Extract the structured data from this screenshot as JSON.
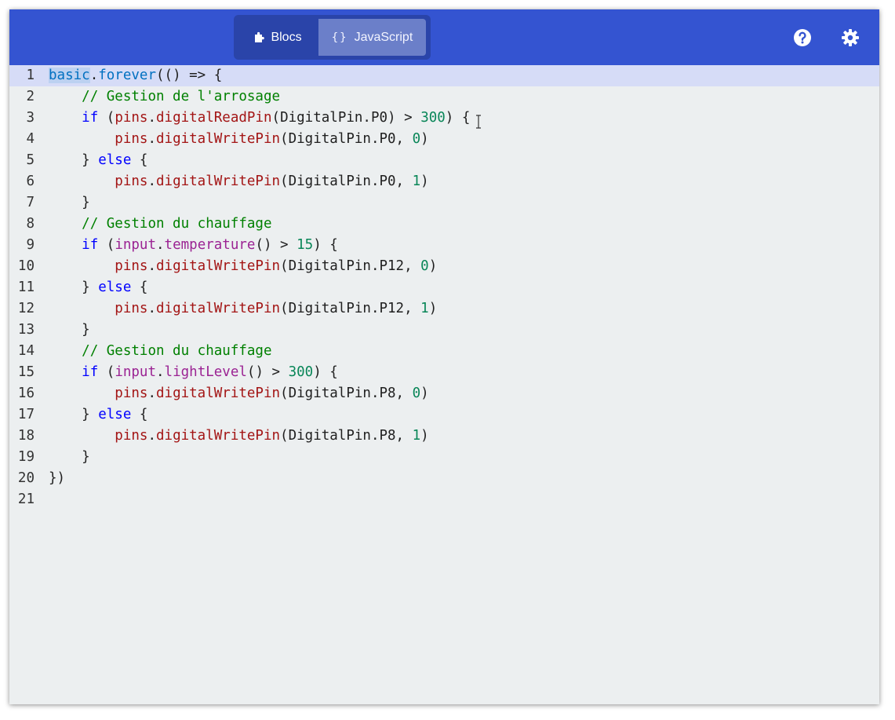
{
  "header": {
    "toggle": {
      "blocs_label": "Blocs",
      "js_icon": "{}",
      "js_label": "JavaScript",
      "active": "JavaScript"
    },
    "icons": [
      "puzzle-icon",
      "help-icon",
      "settings-gear-icon"
    ],
    "colors": {
      "bar": "#3454d1",
      "toggle_bg": "#2a44a9",
      "toggle_active": "#6b7fc9"
    }
  },
  "editor": {
    "language": "JavaScript",
    "active_line": 1,
    "line_numbers": [
      "1",
      "2",
      "3",
      "4",
      "5",
      "6",
      "7",
      "8",
      "9",
      "10",
      "11",
      "12",
      "13",
      "14",
      "15",
      "16",
      "17",
      "18",
      "19",
      "20",
      "21"
    ],
    "lines": [
      [
        {
          "t": "basic",
          "c": "id sel"
        },
        {
          "t": ".",
          "c": ""
        },
        {
          "t": "forever",
          "c": "id"
        },
        {
          "t": "(() => {",
          "c": ""
        }
      ],
      [
        {
          "t": "    ",
          "c": ""
        },
        {
          "t": "// Gestion de l'arrosage",
          "c": "cm"
        }
      ],
      [
        {
          "t": "    ",
          "c": ""
        },
        {
          "t": "if",
          "c": "kw"
        },
        {
          "t": " (",
          "c": ""
        },
        {
          "t": "pins",
          "c": "fn"
        },
        {
          "t": ".",
          "c": ""
        },
        {
          "t": "digitalReadPin",
          "c": "fn"
        },
        {
          "t": "(DigitalPin.P0) > ",
          "c": ""
        },
        {
          "t": "300",
          "c": "num"
        },
        {
          "t": ") {",
          "c": ""
        }
      ],
      [
        {
          "t": "        ",
          "c": ""
        },
        {
          "t": "pins",
          "c": "fn"
        },
        {
          "t": ".",
          "c": ""
        },
        {
          "t": "digitalWritePin",
          "c": "fn"
        },
        {
          "t": "(DigitalPin.P0, ",
          "c": ""
        },
        {
          "t": "0",
          "c": "num"
        },
        {
          "t": ")",
          "c": ""
        }
      ],
      [
        {
          "t": "    } ",
          "c": ""
        },
        {
          "t": "else",
          "c": "kw"
        },
        {
          "t": " {",
          "c": ""
        }
      ],
      [
        {
          "t": "        ",
          "c": ""
        },
        {
          "t": "pins",
          "c": "fn"
        },
        {
          "t": ".",
          "c": ""
        },
        {
          "t": "digitalWritePin",
          "c": "fn"
        },
        {
          "t": "(DigitalPin.P0, ",
          "c": ""
        },
        {
          "t": "1",
          "c": "num"
        },
        {
          "t": ")",
          "c": ""
        }
      ],
      [
        {
          "t": "    }",
          "c": ""
        }
      ],
      [
        {
          "t": "    ",
          "c": ""
        },
        {
          "t": "// Gestion du chauffage",
          "c": "cm"
        }
      ],
      [
        {
          "t": "    ",
          "c": ""
        },
        {
          "t": "if",
          "c": "kw"
        },
        {
          "t": " (",
          "c": ""
        },
        {
          "t": "input",
          "c": "mg"
        },
        {
          "t": ".",
          "c": ""
        },
        {
          "t": "temperature",
          "c": "mg"
        },
        {
          "t": "() > ",
          "c": ""
        },
        {
          "t": "15",
          "c": "num"
        },
        {
          "t": ") {",
          "c": ""
        }
      ],
      [
        {
          "t": "        ",
          "c": ""
        },
        {
          "t": "pins",
          "c": "fn"
        },
        {
          "t": ".",
          "c": ""
        },
        {
          "t": "digitalWritePin",
          "c": "fn"
        },
        {
          "t": "(DigitalPin.P12, ",
          "c": ""
        },
        {
          "t": "0",
          "c": "num"
        },
        {
          "t": ")",
          "c": ""
        }
      ],
      [
        {
          "t": "    } ",
          "c": ""
        },
        {
          "t": "else",
          "c": "kw"
        },
        {
          "t": " {",
          "c": ""
        }
      ],
      [
        {
          "t": "        ",
          "c": ""
        },
        {
          "t": "pins",
          "c": "fn"
        },
        {
          "t": ".",
          "c": ""
        },
        {
          "t": "digitalWritePin",
          "c": "fn"
        },
        {
          "t": "(DigitalPin.P12, ",
          "c": ""
        },
        {
          "t": "1",
          "c": "num"
        },
        {
          "t": ")",
          "c": ""
        }
      ],
      [
        {
          "t": "    }",
          "c": ""
        }
      ],
      [
        {
          "t": "    ",
          "c": ""
        },
        {
          "t": "// Gestion du chauffage",
          "c": "cm"
        }
      ],
      [
        {
          "t": "    ",
          "c": ""
        },
        {
          "t": "if",
          "c": "kw"
        },
        {
          "t": " (",
          "c": ""
        },
        {
          "t": "input",
          "c": "mg"
        },
        {
          "t": ".",
          "c": ""
        },
        {
          "t": "lightLevel",
          "c": "mg"
        },
        {
          "t": "() > ",
          "c": ""
        },
        {
          "t": "300",
          "c": "num"
        },
        {
          "t": ") {",
          "c": ""
        }
      ],
      [
        {
          "t": "        ",
          "c": ""
        },
        {
          "t": "pins",
          "c": "fn"
        },
        {
          "t": ".",
          "c": ""
        },
        {
          "t": "digitalWritePin",
          "c": "fn"
        },
        {
          "t": "(DigitalPin.P8, ",
          "c": ""
        },
        {
          "t": "0",
          "c": "num"
        },
        {
          "t": ")",
          "c": ""
        }
      ],
      [
        {
          "t": "    } ",
          "c": ""
        },
        {
          "t": "else",
          "c": "kw"
        },
        {
          "t": " {",
          "c": ""
        }
      ],
      [
        {
          "t": "        ",
          "c": ""
        },
        {
          "t": "pins",
          "c": "fn"
        },
        {
          "t": ".",
          "c": ""
        },
        {
          "t": "digitalWritePin",
          "c": "fn"
        },
        {
          "t": "(DigitalPin.P8, ",
          "c": ""
        },
        {
          "t": "1",
          "c": "num"
        },
        {
          "t": ")",
          "c": ""
        }
      ],
      [
        {
          "t": "    }",
          "c": ""
        }
      ],
      [
        {
          "t": "})",
          "c": ""
        }
      ],
      []
    ],
    "syntax_colors": {
      "keyword": "#0000ff",
      "comment": "#008000",
      "number": "#098658",
      "identifier": "#0070c1",
      "function": "#a31515",
      "input_member": "#9b2393",
      "active_line_bg": "#d6dcf7",
      "background": "#eceff0"
    }
  }
}
